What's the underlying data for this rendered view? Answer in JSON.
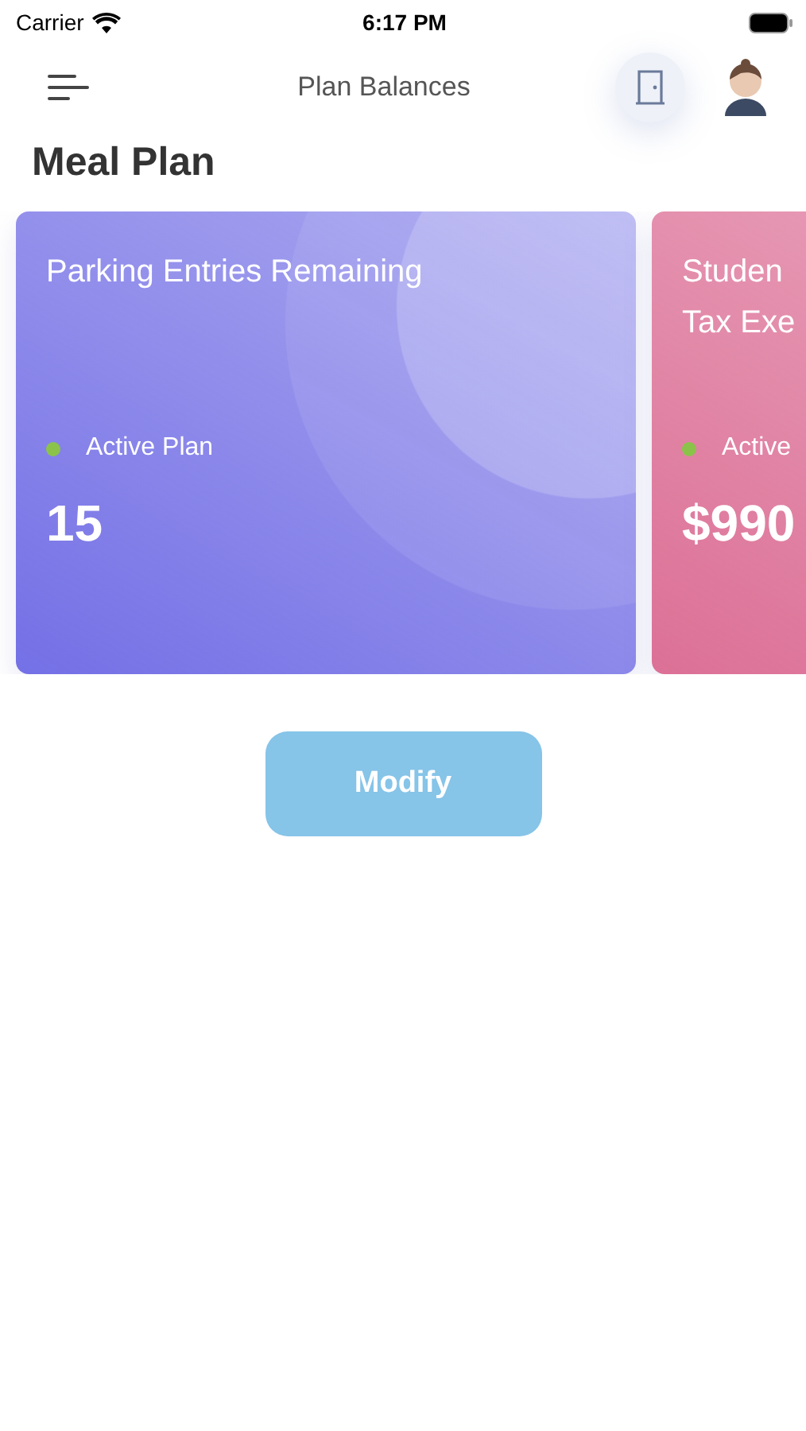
{
  "status_bar": {
    "carrier": "Carrier",
    "time": "6:17 PM"
  },
  "header": {
    "title": "Plan Balances"
  },
  "section": {
    "title": "Meal Plan"
  },
  "cards": [
    {
      "title": [
        "Parking Entries Remaining"
      ],
      "status": "Active Plan",
      "active": true,
      "value": "15",
      "color": "#7470e6"
    },
    {
      "title": [
        "Studen",
        "Tax Exe"
      ],
      "status": "Active",
      "active": true,
      "value": "$990",
      "color": "#dc7096"
    }
  ],
  "button": {
    "label": "Modify"
  }
}
